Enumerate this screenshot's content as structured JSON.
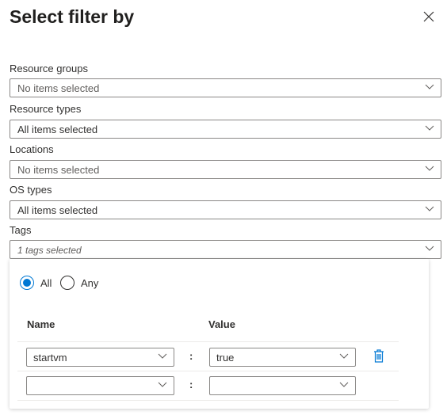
{
  "title": "Select filter by",
  "filters": [
    {
      "label": "Resource groups",
      "value": "No items selected"
    },
    {
      "label": "Resource types",
      "value": "All items selected"
    },
    {
      "label": "Locations",
      "value": "No items selected"
    },
    {
      "label": "OS types",
      "value": "All items selected"
    },
    {
      "label": "Tags",
      "value": "1 tags selected"
    }
  ],
  "tags_panel": {
    "match_options": [
      "All",
      "Any"
    ],
    "selected_match": "All",
    "columns": {
      "name": "Name",
      "value": "Value"
    },
    "separator": ":",
    "rows": [
      {
        "name": "startvm",
        "value": "true"
      },
      {
        "name": "",
        "value": ""
      }
    ]
  },
  "colors": {
    "accent": "#0078d4"
  }
}
